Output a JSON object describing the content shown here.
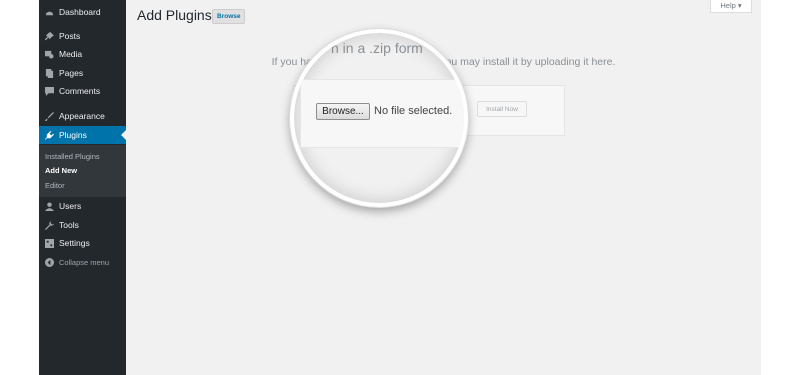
{
  "sidebar": {
    "items": [
      {
        "label": "Dashboard",
        "icon": "dashboard-icon"
      },
      {
        "label": "Posts",
        "icon": "pin-icon"
      },
      {
        "label": "Media",
        "icon": "media-icon"
      },
      {
        "label": "Pages",
        "icon": "pages-icon"
      },
      {
        "label": "Comments",
        "icon": "comment-icon"
      },
      {
        "label": "Appearance",
        "icon": "brush-icon"
      },
      {
        "label": "Plugins",
        "icon": "plugin-icon"
      },
      {
        "label": "Users",
        "icon": "user-icon"
      },
      {
        "label": "Tools",
        "icon": "wrench-icon"
      },
      {
        "label": "Settings",
        "icon": "settings-icon"
      },
      {
        "label": "Collapse menu",
        "icon": "collapse-icon"
      }
    ],
    "submenu": [
      {
        "label": "Installed Plugins"
      },
      {
        "label": "Add New"
      },
      {
        "label": "Editor"
      }
    ]
  },
  "header": {
    "title": "Add Plugins",
    "browse_label": "Browse",
    "help_label": "Help ▾"
  },
  "upload": {
    "instructions": "If you have a plugin in a .zip format, you may install it by uploading it here.",
    "install_label": "Install Now"
  },
  "magnifier": {
    "text": "n in a .zip form",
    "browse_label": "Browse...",
    "file_status": "No file selected."
  },
  "colors": {
    "sidebar_bg": "#23282d",
    "accent": "#0073aa",
    "content_bg": "#f1f1f1"
  }
}
